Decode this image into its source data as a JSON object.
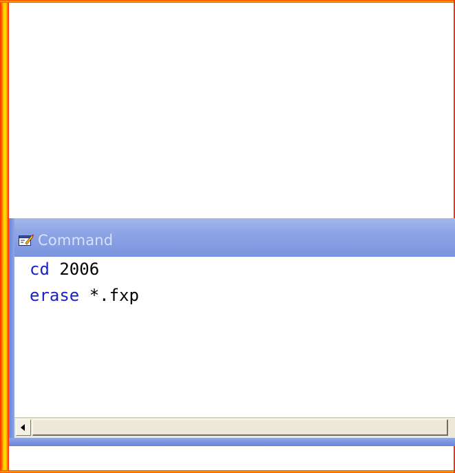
{
  "command_window": {
    "title": "Command",
    "icon": "command-window-icon",
    "lines": [
      {
        "keyword": "cd",
        "rest": " 2006"
      },
      {
        "keyword": "erase",
        "rest": " *.fxp"
      }
    ]
  },
  "colors": {
    "keyword": "#1a22c8",
    "titlebar": "#8ea6e6",
    "frame_outer": "#ff2a00",
    "frame_inner": "#ffd400"
  }
}
